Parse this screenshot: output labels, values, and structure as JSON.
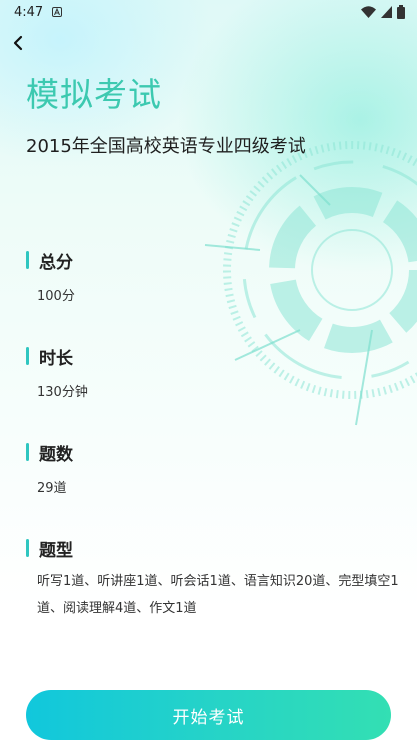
{
  "status_bar": {
    "time": "4:47",
    "icons": [
      "notification-a-icon",
      "wifi-icon",
      "cell-signal-icon",
      "battery-icon"
    ]
  },
  "header": {
    "back_icon": "chevron-left-icon",
    "title": "模拟考试",
    "exam_name": "2015年全国高校英语专业四级考试"
  },
  "sections": {
    "total_score": {
      "title": "总分",
      "value": "100分"
    },
    "duration": {
      "title": "时长",
      "value": "130分钟"
    },
    "question_count": {
      "title": "题数",
      "value": "29道"
    },
    "question_types": {
      "title": "题型",
      "value": "听写1道、听讲座1道、听会话1道、语言知识20道、完型填空1道、阅读理解4道、作文1道"
    }
  },
  "footer": {
    "start_label": "开始考试"
  },
  "colors": {
    "accent": "#3cc9b0",
    "bar": "#2fc6c0",
    "button_start": "#11c7dc",
    "button_end": "#33dfb3"
  }
}
